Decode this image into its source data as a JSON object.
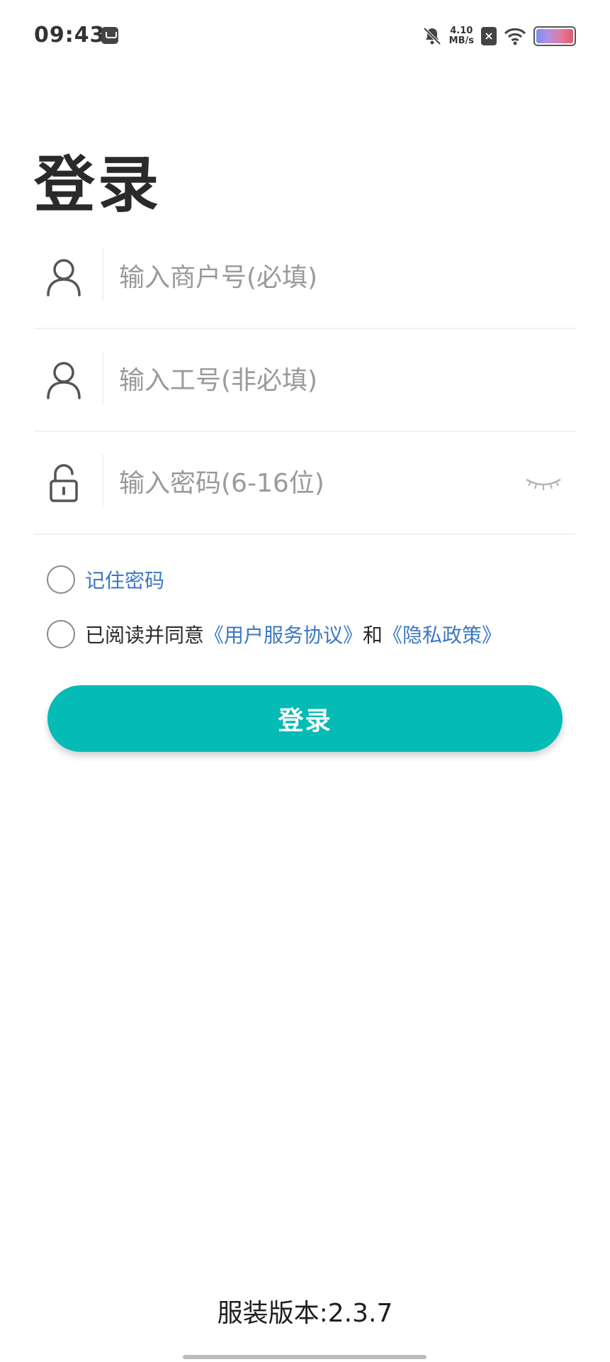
{
  "status_bar": {
    "time": "09:43",
    "net_speed_value": "4.10",
    "net_speed_unit": "MB/s",
    "icons": [
      "app-notification-icon",
      "mute-bell-icon",
      "sim-off-icon",
      "wifi-icon",
      "battery-icon"
    ]
  },
  "page": {
    "title": "登录"
  },
  "form": {
    "merchant_placeholder": "输入商户号(必填)",
    "merchant_value": "",
    "employee_placeholder": "输入工号(非必填)",
    "employee_value": "",
    "password_placeholder": "输入密码(6-16位)",
    "password_value": ""
  },
  "remember": {
    "label": "记住密码",
    "checked": false
  },
  "agreement": {
    "prefix": "已阅读并同意",
    "user_agreement": "《用户服务协议》",
    "conjunction": "和",
    "privacy_policy": "《隐私政策》",
    "checked": false
  },
  "login_button": {
    "label": "登录"
  },
  "footer": {
    "version": "服装版本:2.3.7"
  },
  "colors": {
    "accent": "#05bbb5",
    "link": "#3a78c4",
    "placeholder": "#9a9a9a"
  }
}
